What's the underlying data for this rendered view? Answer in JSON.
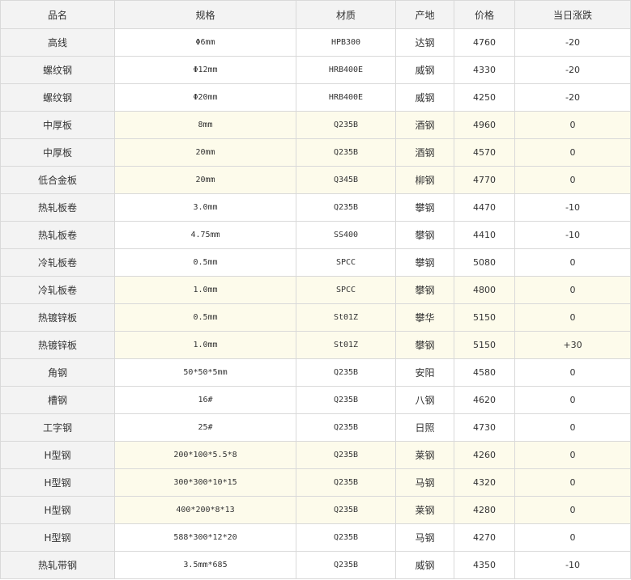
{
  "table": {
    "headers": [
      "品名",
      "规格",
      "材质",
      "产地",
      "价格",
      "当日涨跌"
    ],
    "rows": [
      {
        "name": "高线",
        "spec": "Φ6mm",
        "material": "HPB300",
        "origin": "达钢",
        "price": "4760",
        "change": "-20",
        "highlight": false
      },
      {
        "name": "螺纹钢",
        "spec": "Φ12mm",
        "material": "HRB400E",
        "origin": "威钢",
        "price": "4330",
        "change": "-20",
        "highlight": false
      },
      {
        "name": "螺纹钢",
        "spec": "Φ20mm",
        "material": "HRB400E",
        "origin": "威钢",
        "price": "4250",
        "change": "-20",
        "highlight": false
      },
      {
        "name": "中厚板",
        "spec": "8mm",
        "material": "Q235B",
        "origin": "酒钢",
        "price": "4960",
        "change": "0",
        "highlight": true
      },
      {
        "name": "中厚板",
        "spec": "20mm",
        "material": "Q235B",
        "origin": "酒钢",
        "price": "4570",
        "change": "0",
        "highlight": true
      },
      {
        "name": "低合金板",
        "spec": "20mm",
        "material": "Q345B",
        "origin": "柳钢",
        "price": "4770",
        "change": "0",
        "highlight": true
      },
      {
        "name": "热轧板卷",
        "spec": "3.0mm",
        "material": "Q235B",
        "origin": "攀钢",
        "price": "4470",
        "change": "-10",
        "highlight": false
      },
      {
        "name": "热轧板卷",
        "spec": "4.75mm",
        "material": "SS400",
        "origin": "攀钢",
        "price": "4410",
        "change": "-10",
        "highlight": false
      },
      {
        "name": "冷轧板卷",
        "spec": "0.5mm",
        "material": "SPCC",
        "origin": "攀钢",
        "price": "5080",
        "change": "0",
        "highlight": false
      },
      {
        "name": "冷轧板卷",
        "spec": "1.0mm",
        "material": "SPCC",
        "origin": "攀钢",
        "price": "4800",
        "change": "0",
        "highlight": true
      },
      {
        "name": "热镀锌板",
        "spec": "0.5mm",
        "material": "St01Z",
        "origin": "攀华",
        "price": "5150",
        "change": "0",
        "highlight": true
      },
      {
        "name": "热镀锌板",
        "spec": "1.0mm",
        "material": "St01Z",
        "origin": "攀钢",
        "price": "5150",
        "change": "+30",
        "highlight": true
      },
      {
        "name": "角钢",
        "spec": "50*50*5mm",
        "material": "Q235B",
        "origin": "安阳",
        "price": "4580",
        "change": "0",
        "highlight": false
      },
      {
        "name": "槽钢",
        "spec": "16#",
        "material": "Q235B",
        "origin": "八钢",
        "price": "4620",
        "change": "0",
        "highlight": false
      },
      {
        "name": "工字钢",
        "spec": "25#",
        "material": "Q235B",
        "origin": "日照",
        "price": "4730",
        "change": "0",
        "highlight": false
      },
      {
        "name": "H型钢",
        "spec": "200*100*5.5*8",
        "material": "Q235B",
        "origin": "莱钢",
        "price": "4260",
        "change": "0",
        "highlight": true
      },
      {
        "name": "H型钢",
        "spec": "300*300*10*15",
        "material": "Q235B",
        "origin": "马钢",
        "price": "4320",
        "change": "0",
        "highlight": true
      },
      {
        "name": "H型钢",
        "spec": "400*200*8*13",
        "material": "Q235B",
        "origin": "莱钢",
        "price": "4280",
        "change": "0",
        "highlight": true
      },
      {
        "name": "H型钢",
        "spec": "588*300*12*20",
        "material": "Q235B",
        "origin": "马钢",
        "price": "4270",
        "change": "0",
        "highlight": false
      },
      {
        "name": "热轧带钢",
        "spec": "3.5mm*685",
        "material": "Q235B",
        "origin": "威钢",
        "price": "4350",
        "change": "-10",
        "highlight": false
      }
    ]
  }
}
